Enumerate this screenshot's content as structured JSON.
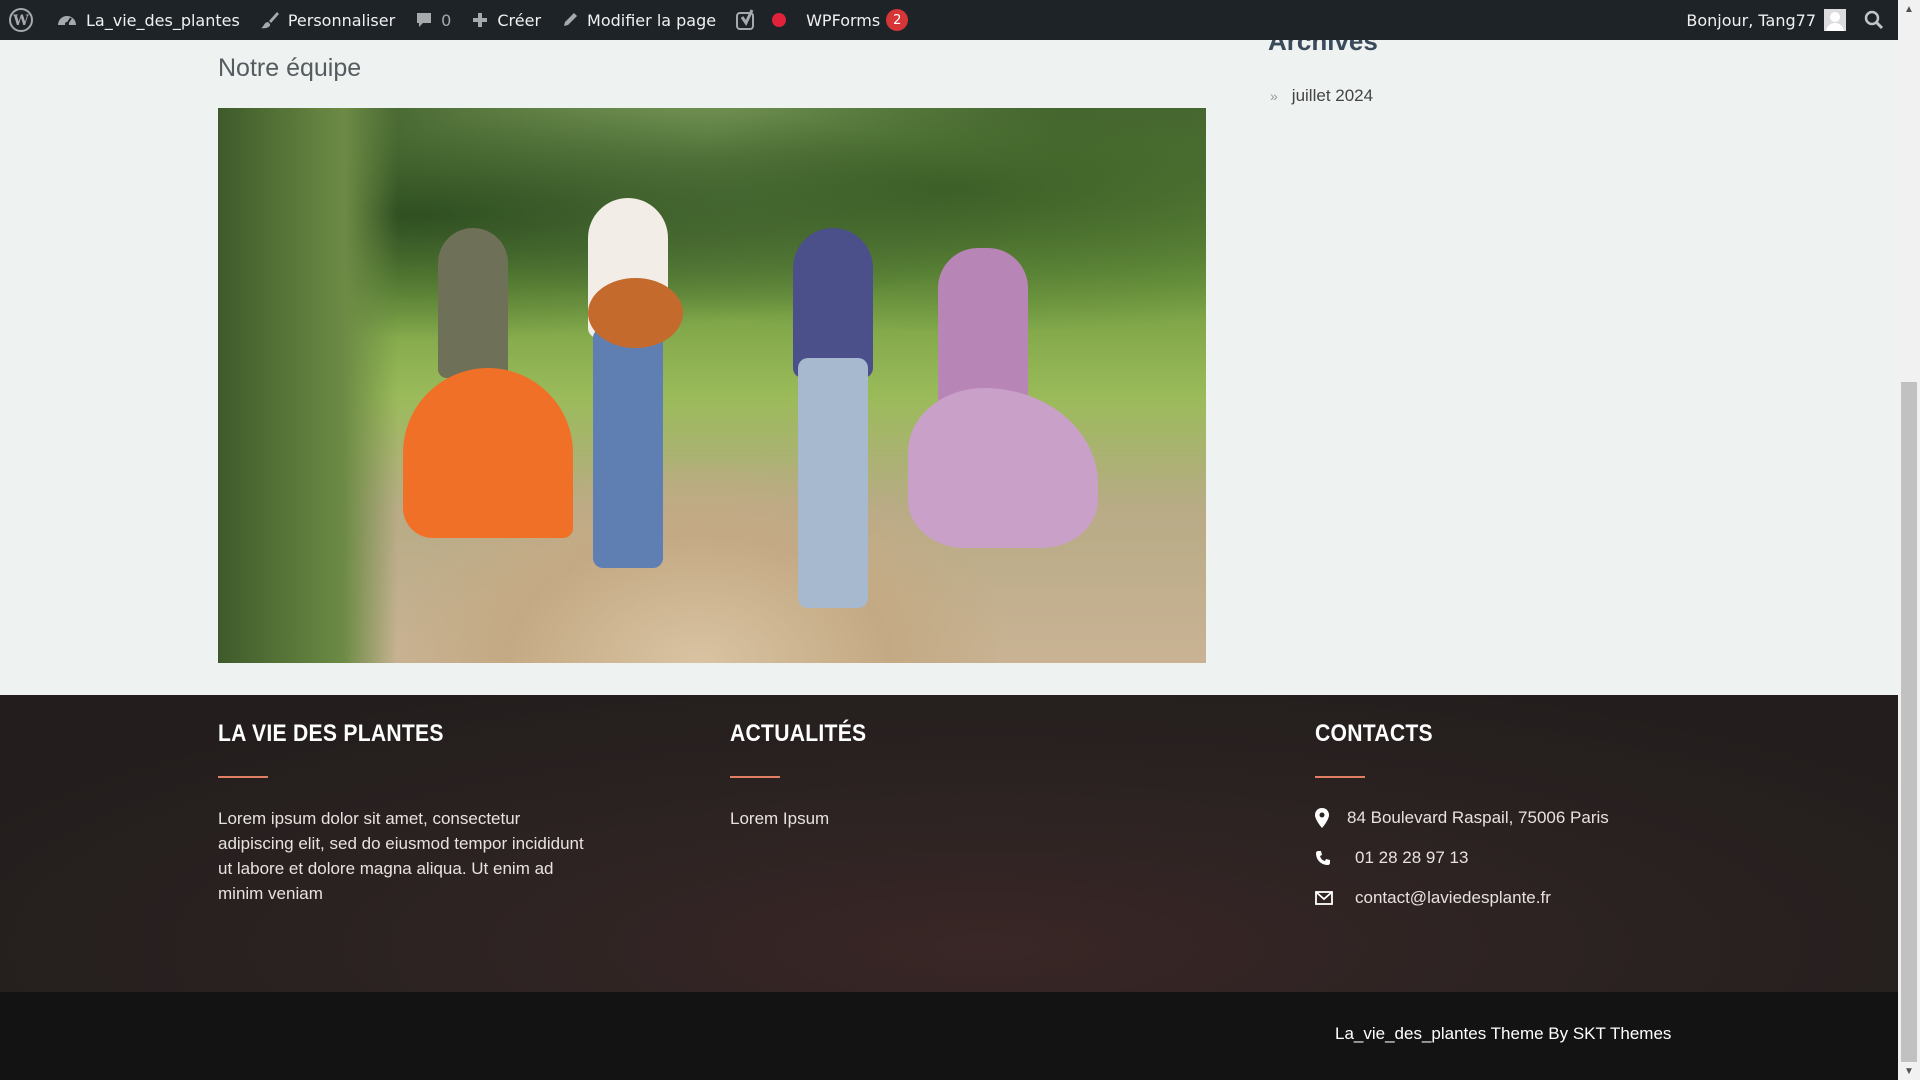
{
  "adminbar": {
    "site_name": "La_vie_des_plantes",
    "customize": "Personnaliser",
    "comments_count": "0",
    "new": "Créer",
    "edit_page": "Modifier la page",
    "wpforms": "WPForms",
    "wpforms_badge": "2",
    "greeting": "Bonjour, Tang77"
  },
  "main": {
    "page_title": "Notre équipe",
    "hero_image_alt": "Groupe de quatre personnes dansant et jouant de la guitare sur un chemin de campagne"
  },
  "sidebar": {
    "archives_title": "Archives",
    "archive_items": [
      "juillet 2024"
    ]
  },
  "footer": {
    "col1": {
      "title": "LA VIE DES PLANTES",
      "text": "Lorem ipsum dolor sit amet, consectetur adipiscing elit, sed do eiusmod tempor incididunt ut labore et dolore magna aliqua. Ut enim ad minim veniam"
    },
    "col2": {
      "title": "ACTUALITÉS",
      "link": "Lorem Ipsum"
    },
    "col3": {
      "title": "CONTACTS",
      "address": "84 Boulevard Raspail, 75006 Paris",
      "phone": "01 28 28 97 13",
      "email": "contact@laviedesplante.fr"
    },
    "credit": "La_vie_des_plantes Theme By SKT Themes"
  },
  "colors": {
    "adminbar_bg": "#1d2327",
    "accent_underline": "#e07f63",
    "badge_red": "#d63638",
    "footer_bottom": "#131314"
  }
}
